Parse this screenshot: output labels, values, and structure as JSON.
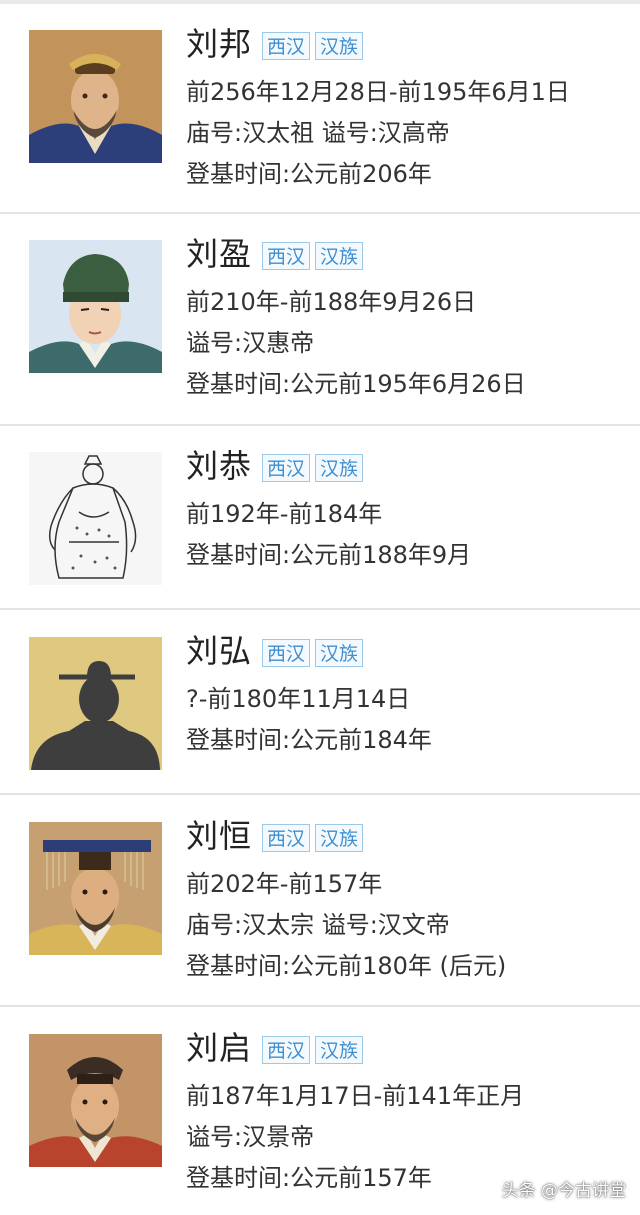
{
  "emperors": [
    {
      "name": "刘邦",
      "tags": [
        "西汉",
        "汉族"
      ],
      "lines": [
        "前256年12月28日-前195年6月1日",
        "庙号:汉太祖 谥号:汉高帝",
        "登基时间:公元前206年"
      ],
      "portrait": "emperor-portrait-painting"
    },
    {
      "name": "刘盈",
      "tags": [
        "西汉",
        "汉族"
      ],
      "lines": [
        "前210年-前188年9月26日",
        "谥号:汉惠帝",
        "登基时间:公元前195年6月26日"
      ],
      "portrait": "emperor-portrait-illustration"
    },
    {
      "name": "刘恭",
      "tags": [
        "西汉",
        "汉族"
      ],
      "lines": [
        "前192年-前184年",
        "登基时间:公元前188年9月"
      ],
      "portrait": "line-drawing-figure"
    },
    {
      "name": "刘弘",
      "tags": [
        "西汉",
        "汉族"
      ],
      "lines": [
        "?-前180年11月14日",
        "登基时间:公元前184年"
      ],
      "portrait": "silhouette-placeholder"
    },
    {
      "name": "刘恒",
      "tags": [
        "西汉",
        "汉族"
      ],
      "lines": [
        "前202年-前157年",
        "庙号:汉太宗 谥号:汉文帝",
        "登基时间:公元前180年 (后元)"
      ],
      "portrait": "emperor-portrait-with-crown"
    },
    {
      "name": "刘启",
      "tags": [
        "西汉",
        "汉族"
      ],
      "lines": [
        "前187年1月17日-前141年正月",
        "谥号:汉景帝",
        "登基时间:公元前157年"
      ],
      "portrait": "emperor-portrait-painting"
    }
  ],
  "watermark": "头条 @今古讲堂",
  "colors": {
    "tag_text": "#3f8fd0",
    "tag_border": "#9dc9e8",
    "divider": "#e4e4e4"
  }
}
